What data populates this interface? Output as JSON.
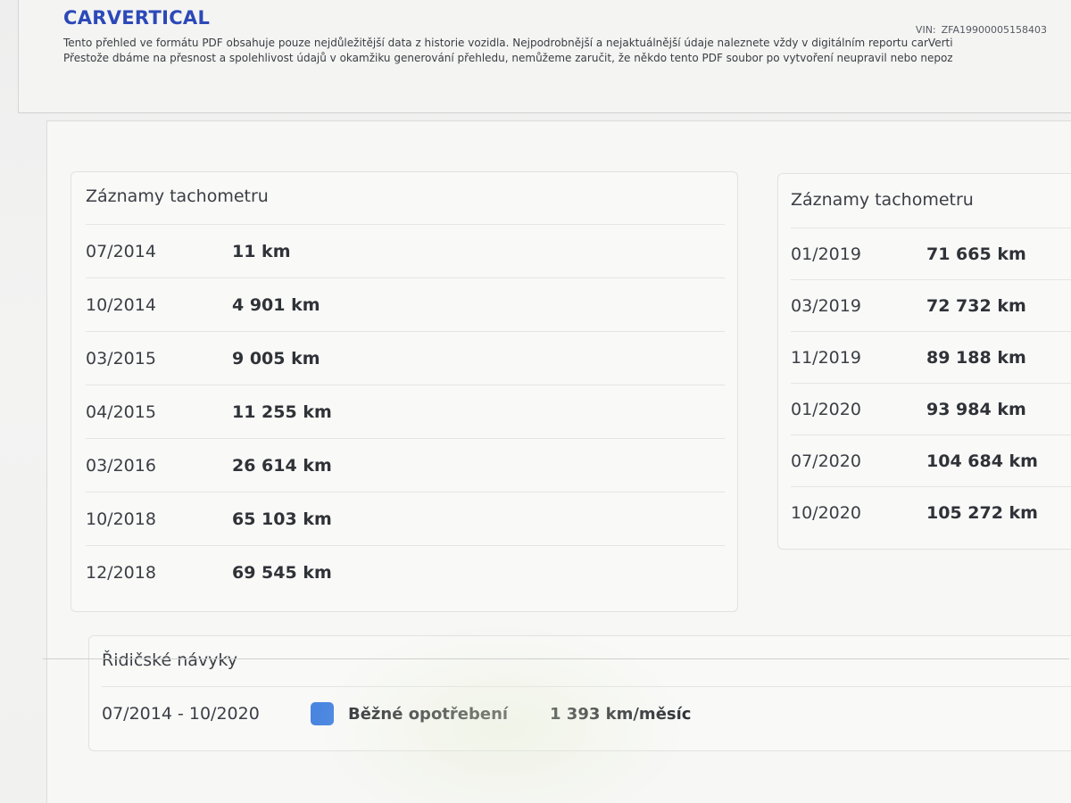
{
  "header": {
    "logo": "CARVERTICAL",
    "vin_label": "VIN:",
    "vin_value": "ZFA19900005158403",
    "disclaimer_line1": "Tento přehled ve formátu PDF obsahuje pouze nejdůležitější data z historie vozidla. Nejpodrobnější a nejaktuálnější údaje naleznete vždy v digitálním reportu carVerti",
    "disclaimer_line2": "Přestože dbáme na přesnost a spolehlivost údajů v okamžiku generování přehledu, nemůžeme zaručit, že někdo tento PDF soubor po vytvoření neupravil nebo nepoz"
  },
  "odometer_left": {
    "title": "Záznamy tachometru",
    "rows": [
      {
        "date": "07/2014",
        "km": "11 km"
      },
      {
        "date": "10/2014",
        "km": "4 901 km"
      },
      {
        "date": "03/2015",
        "km": "9 005 km"
      },
      {
        "date": "04/2015",
        "km": "11 255 km"
      },
      {
        "date": "03/2016",
        "km": "26 614 km"
      },
      {
        "date": "10/2018",
        "km": "65 103 km"
      },
      {
        "date": "12/2018",
        "km": "69 545 km"
      }
    ]
  },
  "odometer_right": {
    "title": "Záznamy tachometru",
    "rows": [
      {
        "date": "01/2019",
        "km": "71 665 km"
      },
      {
        "date": "03/2019",
        "km": "72 732 km"
      },
      {
        "date": "11/2019",
        "km": "89 188 km"
      },
      {
        "date": "01/2020",
        "km": "93 984 km"
      },
      {
        "date": "07/2020",
        "km": "104 684 km"
      },
      {
        "date": "10/2020",
        "km": "105 272 km"
      }
    ]
  },
  "driving_habits": {
    "title": "Řidičské návyky",
    "range": "07/2014 - 10/2020",
    "badge_color": "#4a86e0",
    "label": "Běžné opotřebení",
    "rate": "1 393 km/měsíc"
  }
}
